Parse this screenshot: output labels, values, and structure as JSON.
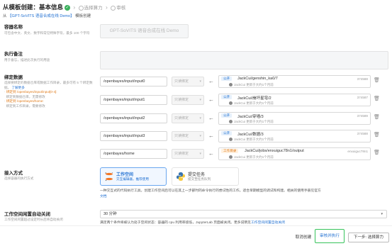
{
  "header": {
    "title": "从模板创建：基本信息",
    "step2": "选择算力",
    "step3": "审核",
    "source_prefix": "从",
    "source_link": "【GPT-SoVITS 语音合成在线 Demo】",
    "source_suffix": "模板创建"
  },
  "name_field": {
    "label": "容器名称",
    "hint": "可包含中文、英文、数字和常见特殊字符，最多 100 个字符",
    "value": "GPT-SoVITS 语音合成在线 Demo"
  },
  "remark_field": {
    "label": "执行备注",
    "hint": "用于备忘，描述此次执行的用途"
  },
  "bind_data": {
    "label": "绑定数据",
    "hint_main": "选择要绑定的数据仓库或数据工作目录，最多可有 5 个绑定数据。",
    "hint_link": "了解更多",
    "hint_line1_tag": "绑定到 /openbayes/input/input[0-4]:",
    "hint_line1_text": "绑定到数据仓库，无需修改",
    "hint_line2_tag": "绑定到 /openbayes/home:",
    "hint_line2_text": "绑定到工作目录，需要修改",
    "readonly_label": "只读绑定",
    "trash_icon": "trash-icon",
    "rows": [
      {
        "path": "/openbayes/input/input0",
        "badge": "公开",
        "name": "JackCui/genshin_ka0/7",
        "time": "JackCui 更新于大约1个月前",
        "num": "374588"
      },
      {
        "path": "/openbayes/input/input1",
        "badge": "公开",
        "name": "JackCui/崩坏星穹/2",
        "time": "JackCui 更新于大约1个月前",
        "num": "374587"
      },
      {
        "path": "/openbayes/input/input2",
        "badge": "公开",
        "name": "JackCui/穿墙/3",
        "time": "JackCui 更新于大约1个月前",
        "num": "374589"
      },
      {
        "path": "/openbayes/input/input3",
        "badge": "公开",
        "name": "JackCui/数据/3",
        "time": "JackCui 更新于大约1个月前",
        "num": "374588"
      },
      {
        "path": "/openbayes/home",
        "badge": "工作目录",
        "name": "JackCui/jobs/enxuiguc78n1/output",
        "time": "JackCui 更新于大约1个月前",
        "num": "enxuiguc78n1"
      }
    ]
  },
  "access": {
    "label": "接入方式",
    "hint": "选择容器的执行方式",
    "card1_title": "工作空间",
    "card1_sub": "交互编辑器，推荐使用",
    "card2_title": "提交任务",
    "card2_sub": "提交至任务队列",
    "desc": "一种交互式的代码执行工具，创建工作空间后可以在其上一步部时的命令执行的尝试性的工作。适合早期模型的调试和构建。相关的使用手册见官方",
    "desc_link": "文档"
  },
  "auto_close": {
    "label": "工作空间闲置自动关闭",
    "hint": "工作空间闲置超过设定时长后将自动关闭",
    "value": "30 分钟",
    "note": "满足两个条件将被认为处于空闲状态：容器的 cpu 利用率极低，JupyterLab 页面被关闭。更多说明见",
    "note_link": "工作空间闲置自动关闭"
  },
  "footer": {
    "cancel": "取消创建",
    "save": "审核并执行",
    "next": "下一步: 选择算力"
  }
}
